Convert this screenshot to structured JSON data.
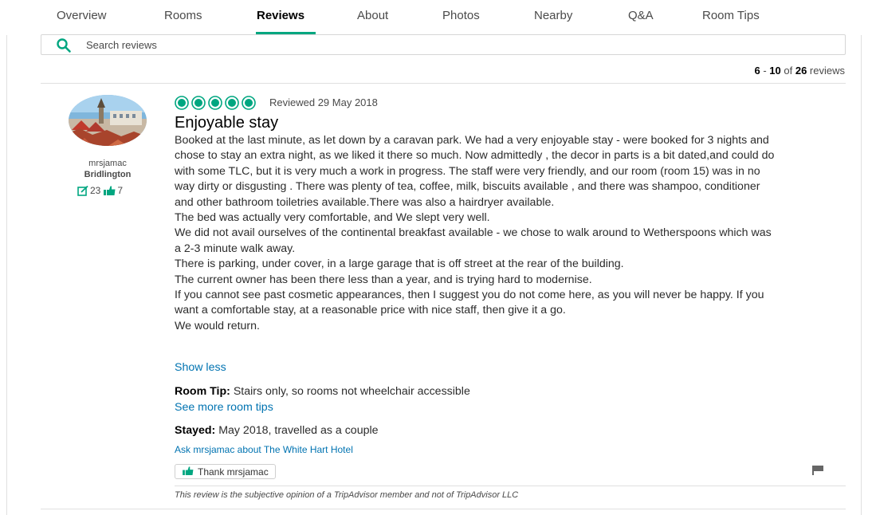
{
  "nav": {
    "tabs": [
      {
        "label": "Overview"
      },
      {
        "label": "Rooms"
      },
      {
        "label": "Reviews"
      },
      {
        "label": "About"
      },
      {
        "label": "Photos"
      },
      {
        "label": "Nearby"
      },
      {
        "label": "Q&A"
      },
      {
        "label": "Room Tips"
      }
    ],
    "active_tab": "Reviews"
  },
  "search": {
    "placeholder": "Search reviews"
  },
  "pagination": {
    "range_start": "6",
    "range_sep": " - ",
    "range_end": "10",
    "of": " of ",
    "total": "26",
    "suffix": " reviews"
  },
  "reviewer": {
    "name": "mrsjamac",
    "location": "Bridlington",
    "review_count": "23",
    "helpful_votes": "7"
  },
  "review": {
    "rating": 5,
    "rating_max": 5,
    "date": "Reviewed 29 May 2018",
    "title": "Enjoyable stay",
    "paragraphs": [
      "Booked at the last minute, as let down by a caravan park. We had a very enjoyable stay - were booked for 3 nights and chose to stay an extra night, as we liked it there so much. Now admittedly , the decor in parts is a bit dated,and could do with some TLC, but it is very much a work in progress. The staff were very friendly, and our room (room 15) was in no way dirty or disgusting . There was plenty of tea, coffee, milk, biscuits available , and there was shampoo, conditioner and other bathroom toiletries available.There was also a hairdryer available.",
      "The bed was actually very comfortable, and We slept very well.",
      "We did not avail ourselves of the continental breakfast available - we chose to walk around to Wetherspoons which was a 2-3 minute walk away.",
      "There is parking, under cover, in a large garage that is off street at the rear of the building.",
      "The current owner has been there less than a year, and is trying hard to modernise.",
      "If you cannot see past cosmetic appearances, then I suggest you do not come here, as you will never be happy. If you want a comfortable stay, at a reasonable price with nice staff, then give it a go.",
      "We would return."
    ],
    "show_less": "Show less",
    "room_tip_label": "Room Tip:",
    "room_tip_text": " Stairs only, so rooms not wheelchair accessible",
    "see_more_tips": "See more room tips",
    "stayed_label": "Stayed:",
    "stayed_text": " May 2018, travelled as a couple",
    "ask_link": "Ask mrsjamac about The White Hart Hotel",
    "thank_button": "Thank mrsjamac",
    "disclaimer": "This review is the subjective opinion of a TripAdvisor member and not of TripAdvisor LLC"
  },
  "colors": {
    "brand_green": "#00a680",
    "link_blue": "#0073b1"
  },
  "icons": [
    "search-icon",
    "review-count-icon",
    "thumbs-up-icon",
    "flag-icon",
    "rating-bubble-icon"
  ]
}
